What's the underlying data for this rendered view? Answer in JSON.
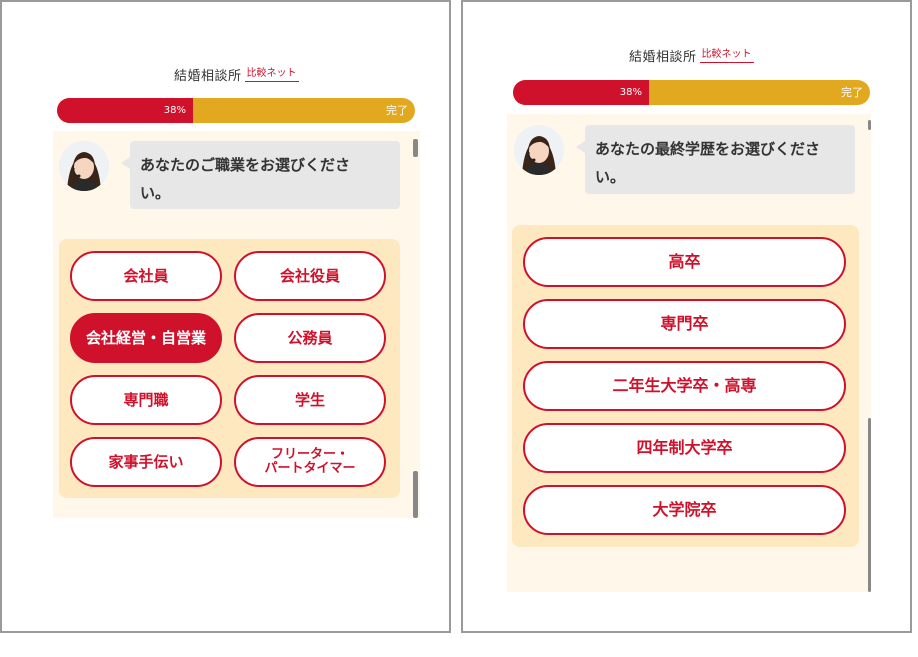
{
  "logo": {
    "main": "結婚相談所",
    "sub": "比較ネット"
  },
  "progress": {
    "percent": 38,
    "percent_label": "38%",
    "complete_label": "完了"
  },
  "colors": {
    "accent_red": "#d0112b",
    "progress_track": "#e2a81f",
    "panel_bg": "#fff8ea",
    "options_bg": "#fde8bf",
    "bubble_bg": "#e7e7e7"
  },
  "left": {
    "question_line1": "あなたのご職業をお選びくださ",
    "question_line2": "い。",
    "options": [
      "会社員",
      "会社役員",
      "会社経営・自営業",
      "公務員",
      "専門職",
      "学生",
      "家事手伝い"
    ],
    "option_freeter_line1": "フリーター・",
    "option_freeter_line2": "パートタイマー",
    "selected_option": "会社経営・自営業"
  },
  "right": {
    "question_line1": "あなたの最終学歴をお選びくださ",
    "question_line2": "い。",
    "options": [
      "高卒",
      "専門卒",
      "二年生大学卒・高専",
      "四年制大学卒",
      "大学院卒"
    ]
  },
  "icons": {
    "avatar": "operator-avatar-icon"
  }
}
